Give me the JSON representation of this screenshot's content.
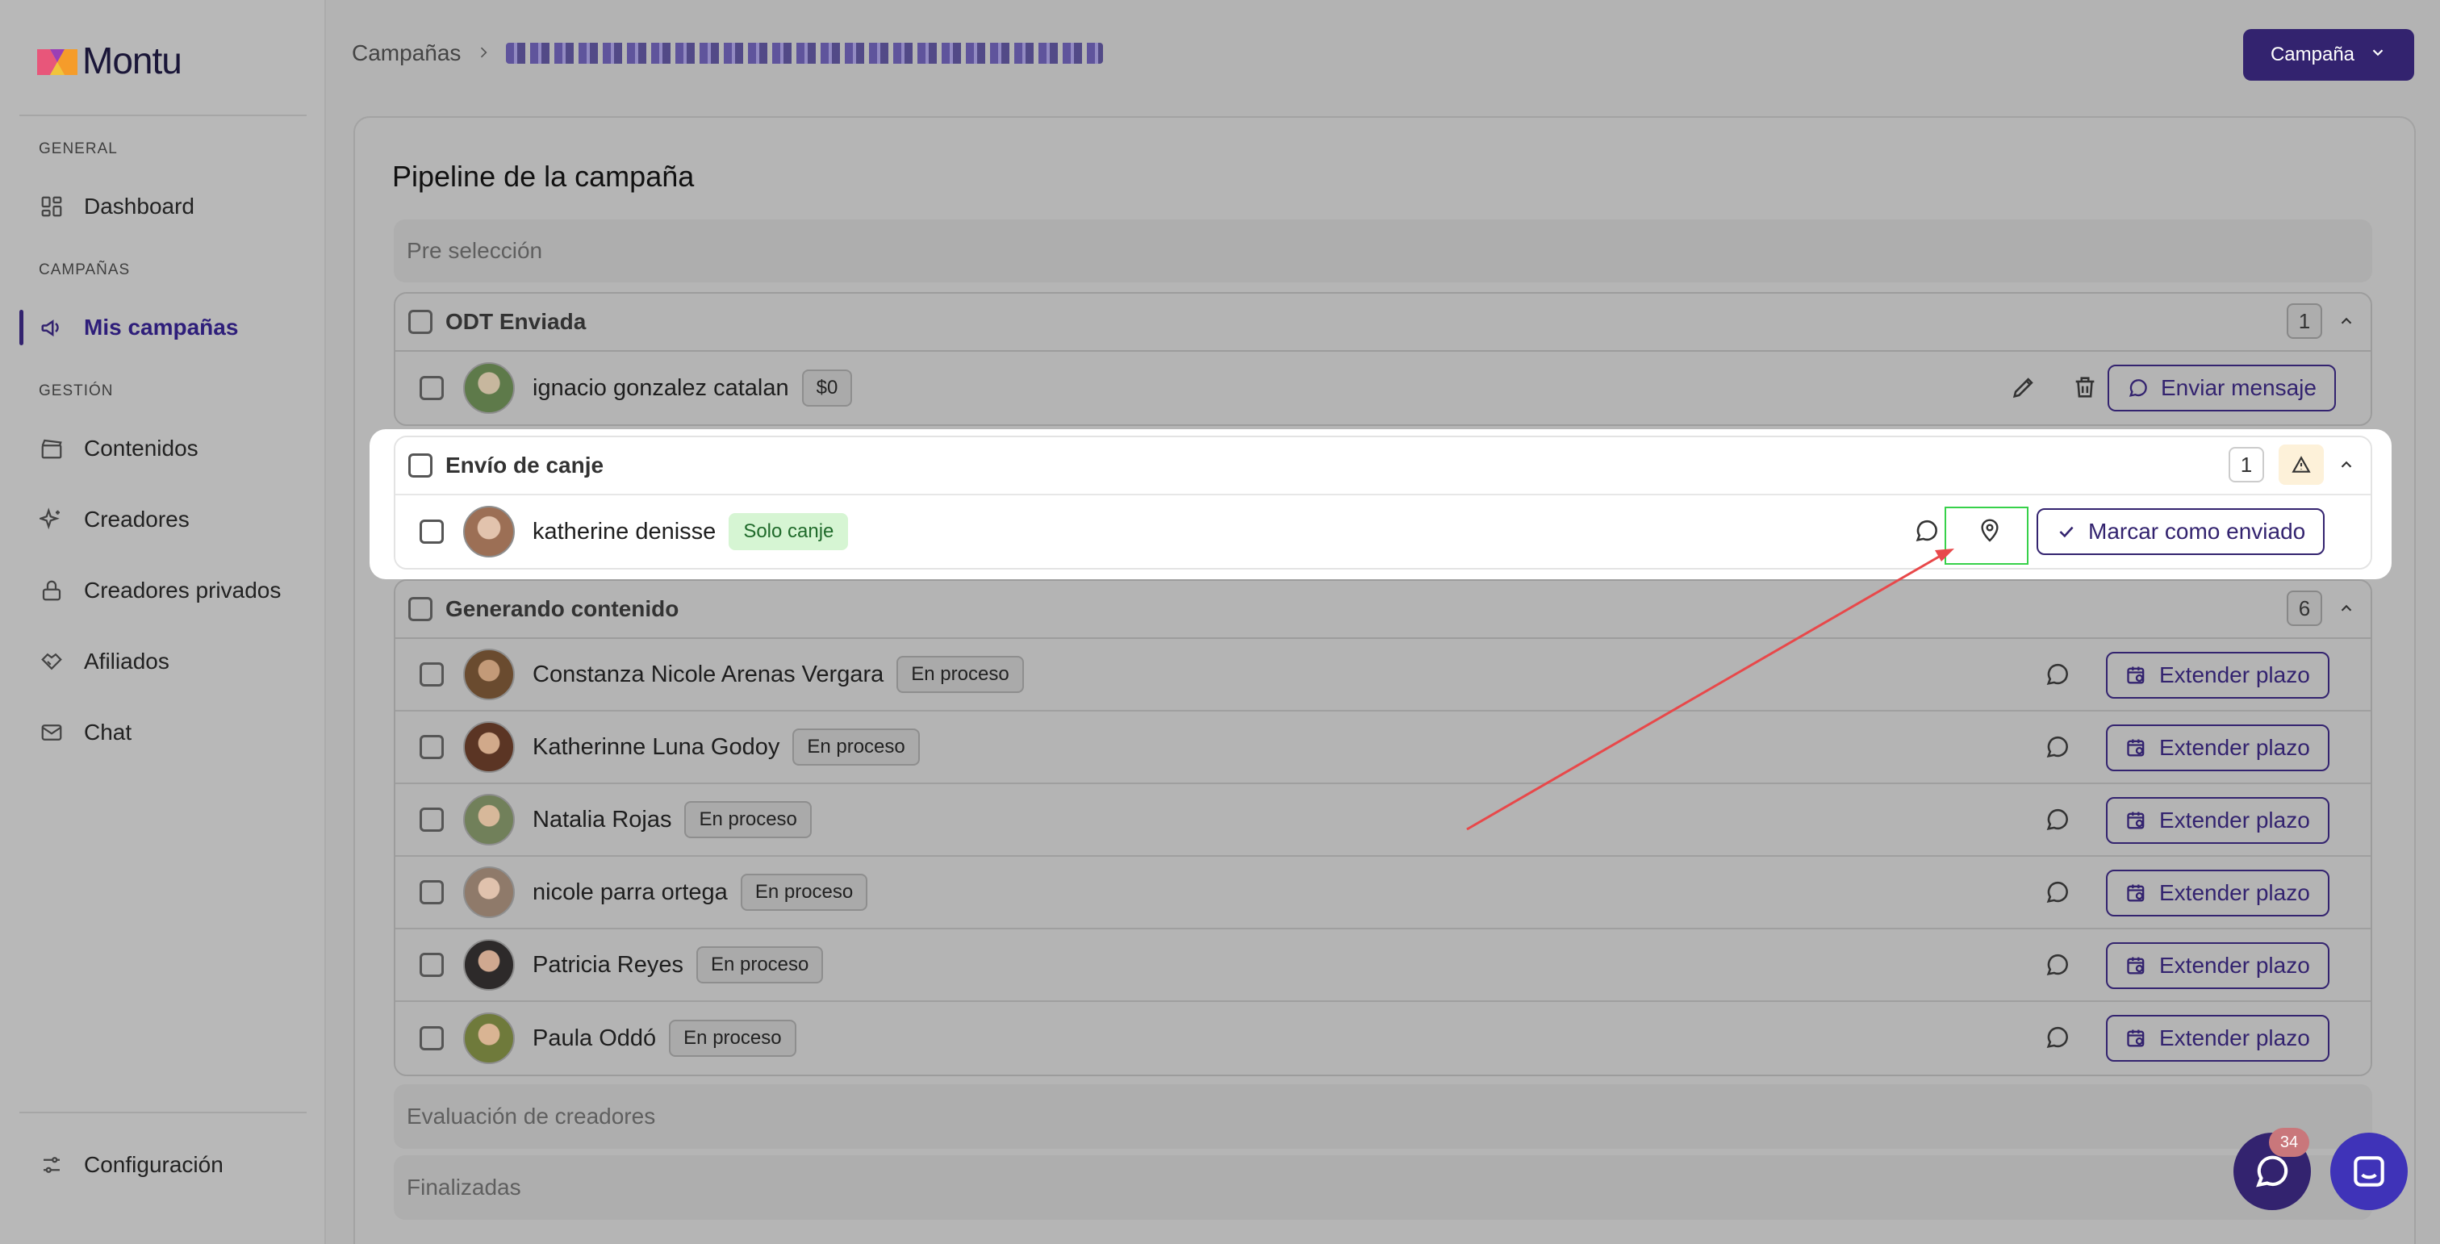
{
  "brand": {
    "name": "Montu"
  },
  "sidebar": {
    "sections": [
      {
        "label": "GENERAL"
      },
      {
        "label": "CAMPAÑAS"
      },
      {
        "label": "GESTIÓN"
      }
    ],
    "items": [
      {
        "label": "Dashboard",
        "icon": "grid-icon"
      },
      {
        "label": "Mis campañas",
        "icon": "megaphone-icon",
        "active": true
      },
      {
        "label": "Contenidos",
        "icon": "clapperboard-icon"
      },
      {
        "label": "Creadores",
        "icon": "sparkles-icon"
      },
      {
        "label": "Creadores privados",
        "icon": "lock-icon"
      },
      {
        "label": "Afiliados",
        "icon": "handshake-icon"
      },
      {
        "label": "Chat",
        "icon": "mail-icon"
      }
    ],
    "footer": {
      "label": "Configuración",
      "icon": "sliders-icon"
    }
  },
  "header": {
    "breadcrumb": "Campañas",
    "campaign_button": "Campaña"
  },
  "pipeline": {
    "title": "Pipeline de la campaña",
    "stage_preseleccion": "Pre selección",
    "stage_evaluacion": "Evaluación de creadores",
    "stage_finalizadas": "Finalizadas",
    "odt": {
      "title": "ODT Enviada",
      "count": "1",
      "row": {
        "name": "ignacio gonzalez catalan",
        "badge": "$0",
        "button": "Enviar mensaje"
      }
    },
    "canje": {
      "title": "Envío de canje",
      "count": "1",
      "row": {
        "name": "katherine denisse",
        "badge": "Solo canje",
        "button": "Marcar como enviado"
      }
    },
    "generando": {
      "title": "Generando contenido",
      "count": "6",
      "button": "Extender plazo",
      "rows": [
        {
          "name": "Constanza Nicole Arenas Vergara",
          "badge": "En proceso"
        },
        {
          "name": "Katherinne Luna Godoy",
          "badge": "En proceso"
        },
        {
          "name": "Natalia Rojas",
          "badge": "En proceso"
        },
        {
          "name": "nicole parra ortega",
          "badge": "En proceso"
        },
        {
          "name": "Patricia Reyes",
          "badge": "En proceso"
        },
        {
          "name": "Paula Oddó",
          "badge": "En proceso"
        }
      ]
    }
  },
  "chat_widget": {
    "unread": "34"
  },
  "colors": {
    "accent": "#33236f",
    "annotation_arrow": "#e8484a",
    "highlight_box": "#37d14a"
  }
}
